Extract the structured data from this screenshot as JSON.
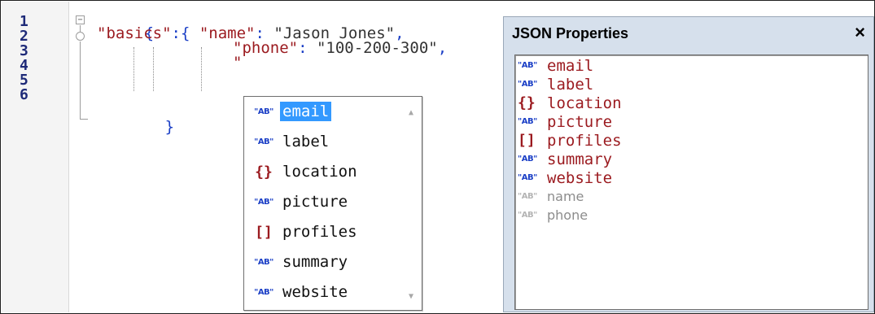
{
  "gutter": {
    "line_numbers": [
      "1",
      "2",
      "3",
      "4",
      "5",
      "6"
    ]
  },
  "code": {
    "line1_brace": "{",
    "line2_key": "\"basics\"",
    "line2_sep": ":{",
    "line2_name_key": "\"name\"",
    "line2_colon": ":",
    "line2_name_val": "\"Jason Jones\"",
    "line2_comma": ",",
    "line3_phone_key": "\"phone\"",
    "line3_colon": ":",
    "line3_phone_val": "\"100-200-300\"",
    "line3_comma": ",",
    "line4_quote": "\"",
    "line6_brace": "}"
  },
  "autocomplete": {
    "items": [
      {
        "label": "email",
        "icon": "string-icon",
        "icon_text": "\"AB\"",
        "selected": true
      },
      {
        "label": "label",
        "icon": "string-icon",
        "icon_text": "\"AB\""
      },
      {
        "label": "location",
        "icon": "object-icon",
        "icon_text": "{}"
      },
      {
        "label": "picture",
        "icon": "string-icon",
        "icon_text": "\"AB\""
      },
      {
        "label": "profiles",
        "icon": "array-icon",
        "icon_text": "[]"
      },
      {
        "label": "summary",
        "icon": "string-icon",
        "icon_text": "\"AB\""
      },
      {
        "label": "website",
        "icon": "string-icon",
        "icon_text": "\"AB\""
      }
    ],
    "scroll_up": "▲",
    "scroll_down": "▼"
  },
  "properties_panel": {
    "title": "JSON Properties",
    "close": "×",
    "items": [
      {
        "label": "email",
        "icon_text": "\"AB\"",
        "icon": "string-icon",
        "used": false
      },
      {
        "label": "label",
        "icon_text": "\"AB\"",
        "icon": "string-icon",
        "used": false
      },
      {
        "label": "location",
        "icon_text": "{}",
        "icon": "object-icon",
        "used": false
      },
      {
        "label": "picture",
        "icon_text": "\"AB\"",
        "icon": "string-icon",
        "used": false
      },
      {
        "label": "profiles",
        "icon_text": "[]",
        "icon": "array-icon",
        "used": false
      },
      {
        "label": "summary",
        "icon_text": "\"AB\"",
        "icon": "string-icon",
        "used": false
      },
      {
        "label": "website",
        "icon_text": "\"AB\"",
        "icon": "string-icon",
        "used": false
      },
      {
        "label": "name",
        "icon_text": "\"AB\"",
        "icon": "string-icon",
        "used": true
      },
      {
        "label": "phone",
        "icon_text": "\"AB\"",
        "icon": "string-icon",
        "used": true
      }
    ]
  },
  "colors": {
    "key": "#9b1a1f",
    "punctuation": "#1b3fc6",
    "selection": "#3399ff",
    "panel_bg": "#d6e0ec"
  }
}
